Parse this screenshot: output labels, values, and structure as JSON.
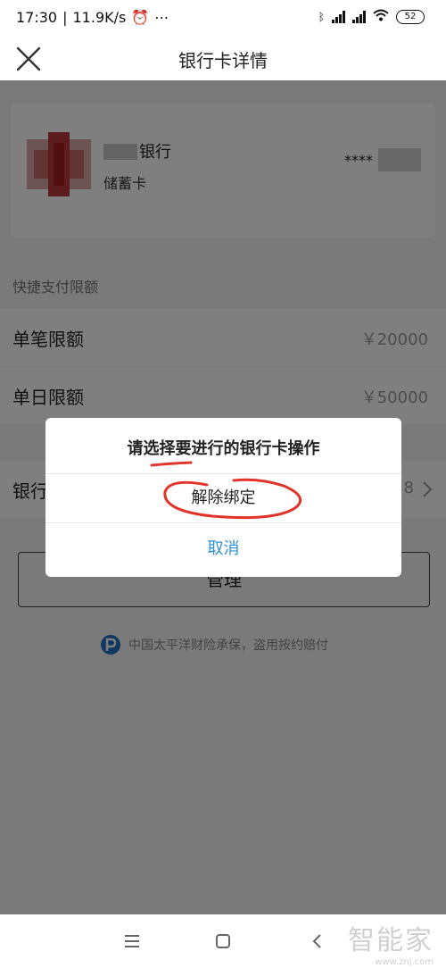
{
  "status_bar": {
    "time": "17:30",
    "speed": "11.9K/s",
    "battery": "52"
  },
  "header": {
    "title": "银行卡详情",
    "close_icon": "close-icon"
  },
  "card": {
    "bank_name": "银行",
    "card_type": "储蓄卡",
    "card_mask": "****"
  },
  "limits": {
    "section_label": "快捷支付限额",
    "single_label": "单笔限额",
    "single_value": "￥20000",
    "daily_label": "单日限额",
    "daily_value": "￥50000"
  },
  "bank_row": {
    "label": "银行",
    "value": "8"
  },
  "manage_button": "管理",
  "insurance_text": "中国太平洋财险承保，盗用按约赔付",
  "dialog": {
    "title": "请选择要进行的银行卡操作",
    "unbind_label": "解除绑定",
    "cancel_label": "取消"
  },
  "watermark": {
    "text": "智能家",
    "url": "www.znj.com"
  },
  "colors": {
    "accent": "#2a8fd9",
    "annotation": "#e0332a",
    "overlay": "rgba(0,0,0,0.5)"
  }
}
